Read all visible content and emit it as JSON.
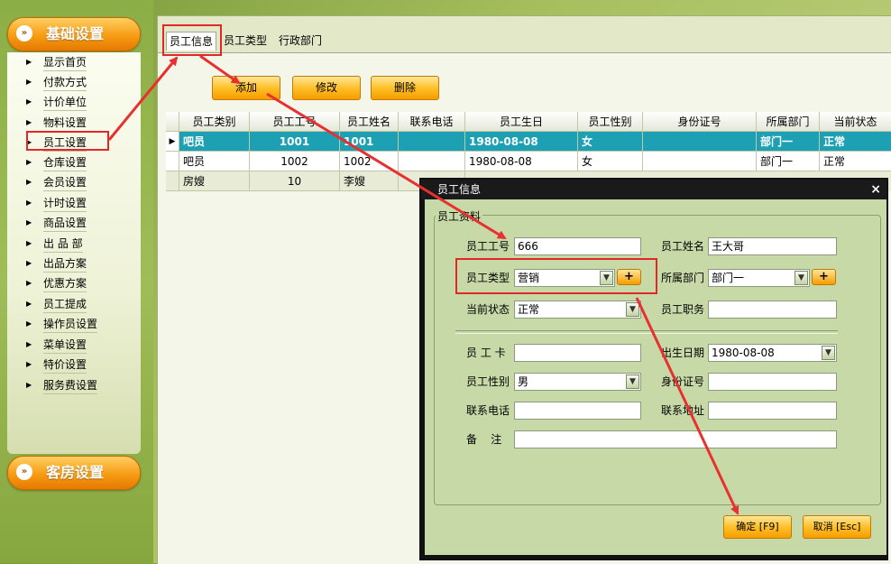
{
  "sidebar": {
    "group1_title": "基础设置",
    "group2_title": "客房设置",
    "items": [
      {
        "label": "显示首页"
      },
      {
        "label": "付款方式"
      },
      {
        "label": "计价单位"
      },
      {
        "label": "物料设置"
      },
      {
        "label": "员工设置"
      },
      {
        "label": "仓库设置"
      },
      {
        "label": "会员设置"
      },
      {
        "label": "计时设置"
      },
      {
        "label": "商品设置"
      },
      {
        "label": "出 品 部"
      },
      {
        "label": "出品方案"
      },
      {
        "label": "优惠方案"
      },
      {
        "label": "员工提成"
      },
      {
        "label": "操作员设置"
      },
      {
        "label": "菜单设置"
      },
      {
        "label": "特价设置"
      },
      {
        "label": "服务费设置"
      }
    ]
  },
  "tabs": [
    {
      "label": "员工信息"
    },
    {
      "label": "员工类型"
    },
    {
      "label": "行政部门"
    }
  ],
  "toolbar": {
    "add": "添加",
    "edit": "修改",
    "delete": "删除"
  },
  "grid": {
    "columns": [
      "员工类别",
      "员工工号",
      "员工姓名",
      "联系电话",
      "员工生日",
      "员工性别",
      "身份证号",
      "所属部门",
      "当前状态"
    ],
    "rows": [
      {
        "type": "吧员",
        "id": "1001",
        "name": "1001",
        "phone": "",
        "birthday": "1980-08-08",
        "gender": "女",
        "idcard": "",
        "dept": "部门一",
        "status": "正常"
      },
      {
        "type": "吧员",
        "id": "1002",
        "name": "1002",
        "phone": "",
        "birthday": "1980-08-08",
        "gender": "女",
        "idcard": "",
        "dept": "部门一",
        "status": "正常"
      },
      {
        "type": "房嫂",
        "id": "10",
        "name": "李嫂",
        "phone": "",
        "birthday": "",
        "gender": "",
        "idcard": "",
        "dept": "",
        "status": ""
      }
    ]
  },
  "dialog": {
    "title": "员工信息",
    "close": "×",
    "legend": "员工资料",
    "labels": {
      "emp_no": "员工工号",
      "emp_name": "员工姓名",
      "emp_type": "员工类型",
      "dept": "所属部门",
      "status": "当前状态",
      "position": "员工职务",
      "card": "员 工 卡",
      "birthday": "出生日期",
      "gender": "员工性别",
      "idcard": "身份证号",
      "phone": "联系电话",
      "address": "联系地址",
      "remark": "备    注"
    },
    "values": {
      "emp_no": "666",
      "emp_name": "王大哥",
      "emp_type": "营销",
      "dept": "部门一",
      "status": "正常",
      "position": "",
      "card": "",
      "birthday": "1980-08-08",
      "gender": "男",
      "idcard": "",
      "phone": "",
      "address": "",
      "remark": ""
    },
    "plus": "+",
    "ok": "确定 [F9]",
    "cancel": "取消 [Esc]"
  },
  "colors": {
    "highlight": "#e02828",
    "selected_row": "#1ea0b4",
    "accent": "#f59c00"
  }
}
